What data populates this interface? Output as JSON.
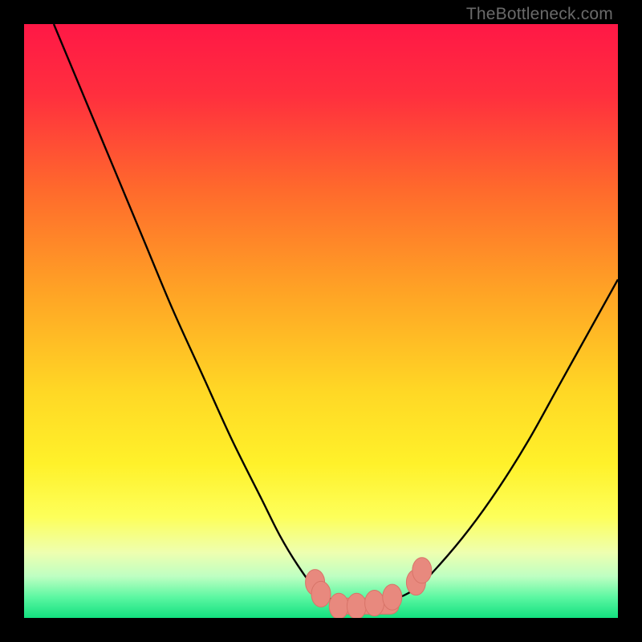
{
  "watermark": "TheBottleneck.com",
  "colors": {
    "frame": "#000000",
    "gradient_stops": [
      {
        "offset": 0.0,
        "color": "#ff1846"
      },
      {
        "offset": 0.12,
        "color": "#ff2f3e"
      },
      {
        "offset": 0.28,
        "color": "#ff6a2c"
      },
      {
        "offset": 0.45,
        "color": "#ffa325"
      },
      {
        "offset": 0.62,
        "color": "#ffd825"
      },
      {
        "offset": 0.74,
        "color": "#fff12a"
      },
      {
        "offset": 0.83,
        "color": "#fdff5a"
      },
      {
        "offset": 0.89,
        "color": "#eeffb0"
      },
      {
        "offset": 0.93,
        "color": "#beffc2"
      },
      {
        "offset": 0.965,
        "color": "#5cf7a2"
      },
      {
        "offset": 1.0,
        "color": "#13e07f"
      }
    ],
    "curve": "#000000",
    "marker_fill": "#e8897e",
    "marker_stroke": "#d87468"
  },
  "chart_data": {
    "type": "line",
    "title": "",
    "xlabel": "",
    "ylabel": "",
    "xlim": [
      0,
      100
    ],
    "ylim": [
      0,
      100
    ],
    "grid": false,
    "series": [
      {
        "name": "bottleneck-curve",
        "x": [
          5,
          10,
          15,
          20,
          25,
          30,
          35,
          40,
          43,
          46,
          49,
          52,
          55,
          58,
          62,
          66,
          70,
          75,
          80,
          85,
          90,
          95,
          100
        ],
        "y": [
          100,
          88,
          76,
          64,
          52,
          41,
          30,
          20,
          14,
          9,
          5,
          3,
          2,
          2,
          3,
          5,
          9,
          15,
          22,
          30,
          39,
          48,
          57
        ]
      }
    ],
    "markers": [
      {
        "name": "optimal-cluster-left",
        "x": 49,
        "y": 6
      },
      {
        "name": "optimal-cluster-left2",
        "x": 50,
        "y": 4
      },
      {
        "name": "optimal-trough-1",
        "x": 53,
        "y": 2
      },
      {
        "name": "optimal-trough-2",
        "x": 56,
        "y": 2
      },
      {
        "name": "optimal-trough-3",
        "x": 59,
        "y": 2.5
      },
      {
        "name": "optimal-trough-4",
        "x": 62,
        "y": 3.5
      },
      {
        "name": "optimal-cluster-right",
        "x": 66,
        "y": 6
      },
      {
        "name": "optimal-cluster-right2",
        "x": 67,
        "y": 8
      }
    ]
  }
}
